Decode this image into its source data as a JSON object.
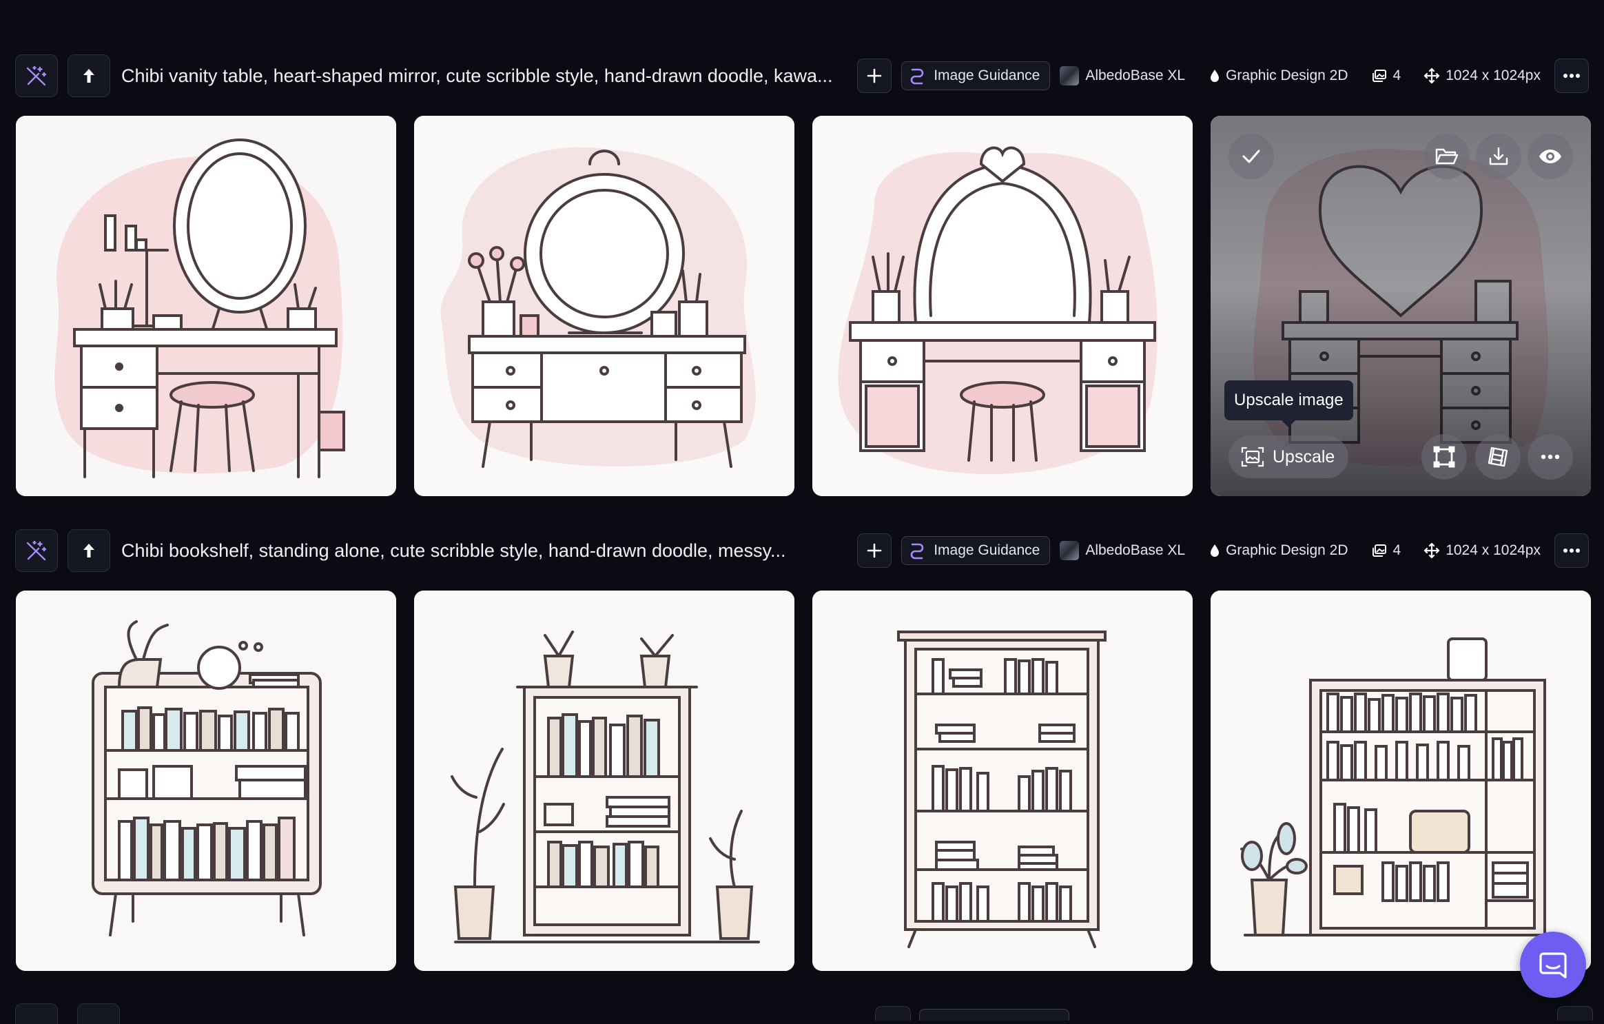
{
  "generations": [
    {
      "prompt": "Chibi vanity table, heart-shaped mirror, cute scribble style, hand-drawn doodle, kawa...",
      "guidance_label": "Image Guidance",
      "model": "AlbedoBase XL",
      "style": "Graphic Design 2D",
      "count": "4",
      "dimensions": "1024 x 1024px",
      "images": [
        {
          "subject": "vanity-oval-mirror"
        },
        {
          "subject": "vanity-round-mirror"
        },
        {
          "subject": "vanity-crown-mirror"
        },
        {
          "subject": "vanity-heart-mirror",
          "hovered": true
        }
      ]
    },
    {
      "prompt": "Chibi bookshelf, standing alone, cute scribble style, hand-drawn doodle, messy...",
      "guidance_label": "Image Guidance",
      "model": "AlbedoBase XL",
      "style": "Graphic Design 2D",
      "count": "4",
      "dimensions": "1024 x 1024px",
      "images": [
        {
          "subject": "bookshelf-plant-top"
        },
        {
          "subject": "bookshelf-with-plants"
        },
        {
          "subject": "bookshelf-tall"
        },
        {
          "subject": "bookshelf-wide"
        }
      ]
    }
  ],
  "hover_overlay": {
    "upscale_label": "Upscale",
    "tooltip": "Upscale image"
  },
  "colors": {
    "background": "#0b0c13",
    "accent": "#8b5cf6",
    "chat": "#6e5df0",
    "sketch": "#4a3c3f",
    "pink": "#f4d7d8"
  }
}
